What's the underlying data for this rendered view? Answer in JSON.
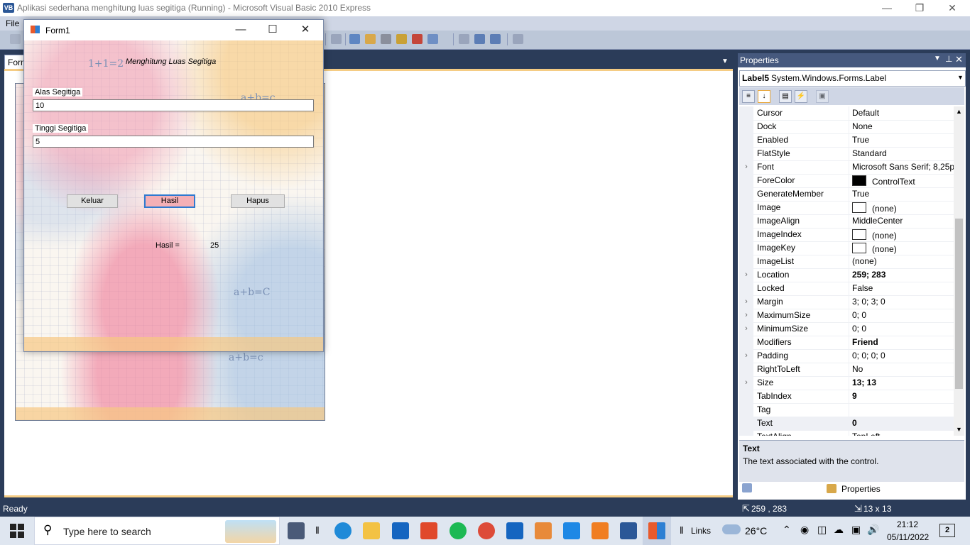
{
  "window": {
    "title": "Aplikasi sederhana menghitung luas segitiga (Running) - Microsoft Visual Basic 2010 Express",
    "app_icon": "VB"
  },
  "menu": {
    "file": "File"
  },
  "doc_tab": {
    "label": "Form"
  },
  "form1": {
    "title": "Form1",
    "heading": "Menghitung Luas Segitiga",
    "alas_label": "Alas Segitiga",
    "alas_value": "10",
    "tinggi_label": "Tinggi Segitiga",
    "tinggi_value": "5",
    "btn_keluar": "Keluar",
    "btn_hasil": "Hasil",
    "btn_hapus": "Hapus",
    "hasil_label": "Hasil =",
    "hasil_value": "25",
    "art_text": [
      "1+1=2",
      "a+b=c",
      "a+b=C",
      "a+b=c"
    ]
  },
  "properties": {
    "panel_title": "Properties",
    "selected_name": "Label5",
    "selected_type": "System.Windows.Forms.Label",
    "rows": [
      {
        "name": "Cursor",
        "value": "Default",
        "expand": false,
        "bold": false
      },
      {
        "name": "Dock",
        "value": "None",
        "expand": false,
        "bold": false
      },
      {
        "name": "Enabled",
        "value": "True",
        "expand": false,
        "bold": false
      },
      {
        "name": "FlatStyle",
        "value": "Standard",
        "expand": false,
        "bold": false
      },
      {
        "name": "Font",
        "value": "Microsoft Sans Serif; 8,25pt",
        "expand": true,
        "bold": false
      },
      {
        "name": "ForeColor",
        "value": "ControlText",
        "expand": false,
        "bold": false,
        "swatch": "#000000"
      },
      {
        "name": "GenerateMember",
        "value": "True",
        "expand": false,
        "bold": false
      },
      {
        "name": "Image",
        "value": "(none)",
        "expand": false,
        "bold": false,
        "swatch": "#ffffff"
      },
      {
        "name": "ImageAlign",
        "value": "MiddleCenter",
        "expand": false,
        "bold": false
      },
      {
        "name": "ImageIndex",
        "value": "(none)",
        "expand": false,
        "bold": false,
        "swatch": "#ffffff"
      },
      {
        "name": "ImageKey",
        "value": "(none)",
        "expand": false,
        "bold": false,
        "swatch": "#ffffff"
      },
      {
        "name": "ImageList",
        "value": "(none)",
        "expand": false,
        "bold": false
      },
      {
        "name": "Location",
        "value": "259; 283",
        "expand": true,
        "bold": true
      },
      {
        "name": "Locked",
        "value": "False",
        "expand": false,
        "bold": false
      },
      {
        "name": "Margin",
        "value": "3; 0; 3; 0",
        "expand": true,
        "bold": false
      },
      {
        "name": "MaximumSize",
        "value": "0; 0",
        "expand": true,
        "bold": false
      },
      {
        "name": "MinimumSize",
        "value": "0; 0",
        "expand": true,
        "bold": false
      },
      {
        "name": "Modifiers",
        "value": "Friend",
        "expand": false,
        "bold": true
      },
      {
        "name": "Padding",
        "value": "0; 0; 0; 0",
        "expand": true,
        "bold": false
      },
      {
        "name": "RightToLeft",
        "value": "No",
        "expand": false,
        "bold": false
      },
      {
        "name": "Size",
        "value": "13; 13",
        "expand": true,
        "bold": true
      },
      {
        "name": "TabIndex",
        "value": "9",
        "expand": false,
        "bold": true
      },
      {
        "name": "Tag",
        "value": "",
        "expand": false,
        "bold": false
      },
      {
        "name": "Text",
        "value": "0",
        "expand": false,
        "bold": true
      },
      {
        "name": "TextAlign",
        "value": "TopLeft",
        "expand": false,
        "bold": false
      }
    ],
    "desc_title": "Text",
    "desc_text": "The text associated with the control.",
    "tab_solution": "Solution Explorer",
    "tab_properties": "Properties"
  },
  "status": {
    "text": "Ready",
    "location": "259 , 283",
    "size": "13 x 13"
  },
  "taskbar": {
    "search_placeholder": "Type here to search",
    "links": "Links",
    "temperature": "26°C",
    "time": "21:12",
    "date": "05/11/2022",
    "notifications": "2",
    "colors": {
      "edge": "#1f8ad8",
      "explorer": "#f3c244",
      "mail": "#1565c0",
      "office": "#e0492b",
      "spotify": "#1db954",
      "chrome": "#dd4b39",
      "vscode": "#1e88e5",
      "sublime": "#f07e22",
      "vb": "#2b5797"
    }
  }
}
